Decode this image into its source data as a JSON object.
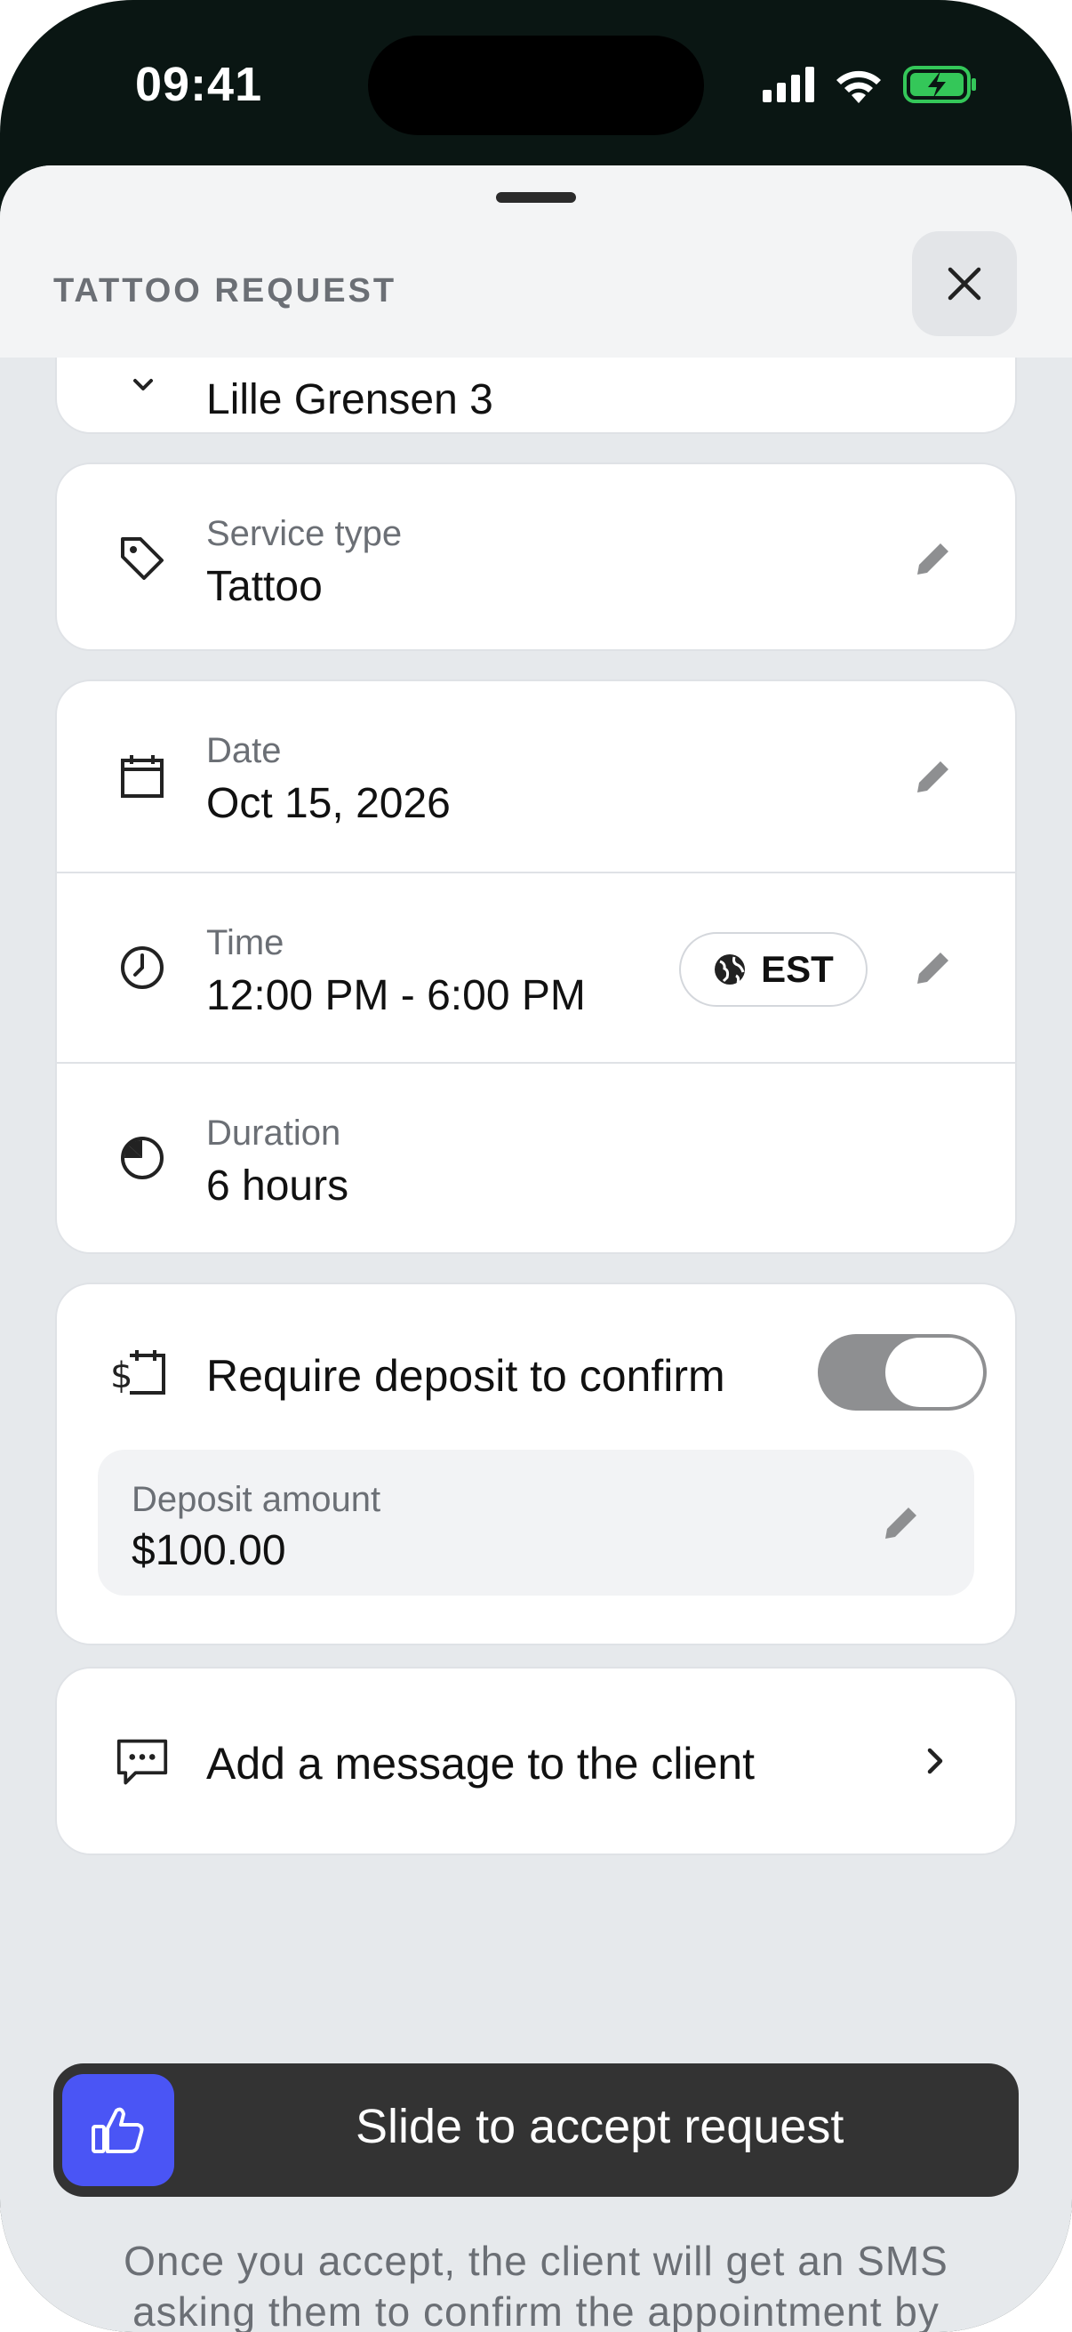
{
  "status_bar": {
    "time": "09:41"
  },
  "header": {
    "title": "TATTOO REQUEST",
    "close_icon": "close-icon"
  },
  "location": {
    "value": "Lille Grensen 3"
  },
  "service": {
    "label": "Service type",
    "value": "Tattoo"
  },
  "schedule": {
    "date_label": "Date",
    "date_value": "Oct 15, 2026",
    "time_label": "Time",
    "time_value": "12:00 PM - 6:00 PM",
    "timezone": "EST",
    "duration_label": "Duration",
    "duration_value": "6 hours"
  },
  "deposit": {
    "toggle_label": "Require deposit to confirm",
    "toggle_on": true,
    "amount_label": "Deposit amount",
    "amount_value": "$100.00"
  },
  "message": {
    "label": "Add a message to the client"
  },
  "slider": {
    "label": "Slide to accept request"
  },
  "footer": {
    "note": "Once you accept, the client will get an SMS asking them to confirm the appointment by paying their deposit."
  },
  "colors": {
    "accent": "#4a55f5",
    "slider_bg": "#333333",
    "battery_green": "#34c759"
  }
}
